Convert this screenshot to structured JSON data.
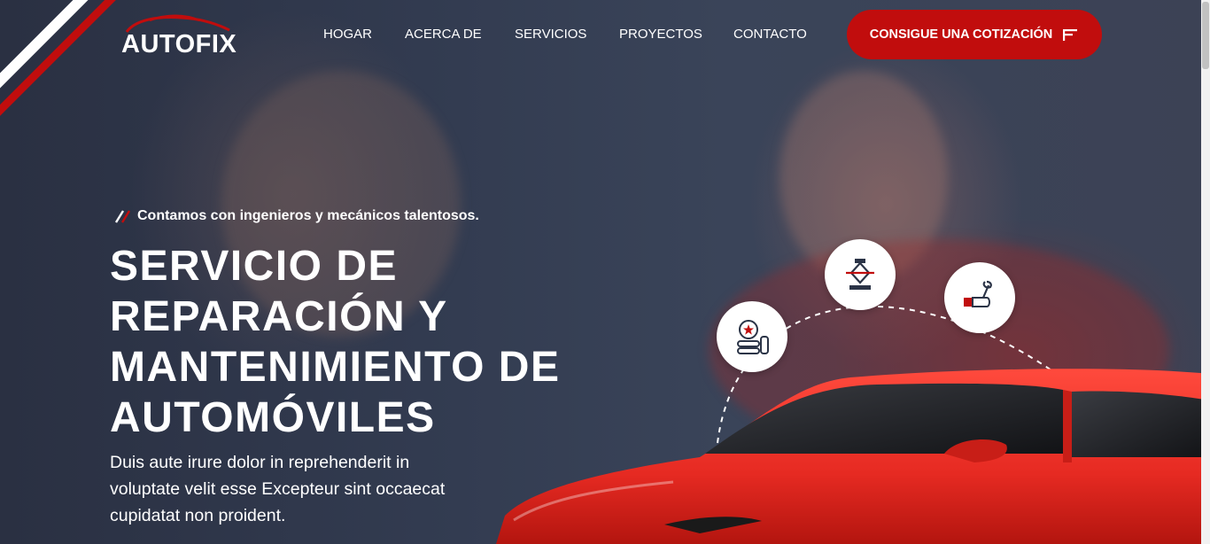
{
  "brand": {
    "name": "AUTOFIX"
  },
  "nav": {
    "items": [
      "HOGAR",
      "ACERCA DE",
      "SERVICIOS",
      "PROYECTOS",
      "CONTACTO"
    ],
    "cta_label": "CONSIGUE UNA COTIZACIÓN"
  },
  "hero": {
    "tagline": "Contamos con ingenieros y mecánicos talentosos.",
    "headline_lines": [
      "SERVICIO DE",
      "REPARACIÓN Y",
      "MANTENIMIENTO DE",
      "AUTOMÓVILES"
    ],
    "description_lines": [
      "Duis aute irure dolor in reprehenderit in",
      "voluptate velit esse Excepteur sint occaecat",
      "cupidatat non proident."
    ]
  },
  "service_icons": [
    "tire-icon",
    "car-jack-icon",
    "wrench-hand-icon"
  ],
  "colors": {
    "accent": "#c10d0d",
    "car": "#e62a22",
    "overlay": "#2b3447",
    "text": "#ffffff"
  }
}
